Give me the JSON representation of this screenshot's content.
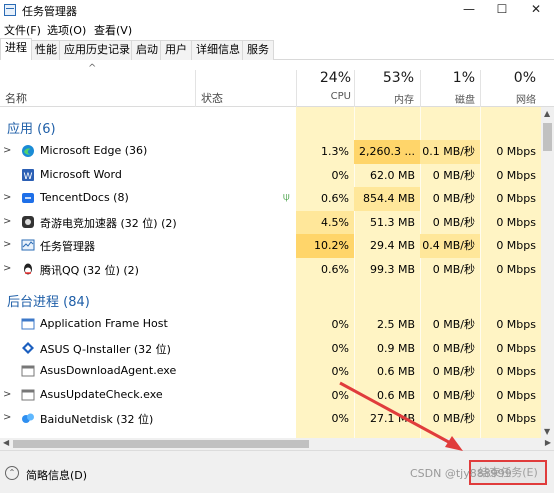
{
  "window": {
    "title": "任务管理器",
    "icon": "task-manager-icon",
    "controls": [
      "—",
      "☐",
      "✕"
    ]
  },
  "menu": [
    "文件(F)",
    "选项(O)",
    "查看(V)"
  ],
  "tabs": [
    "进程",
    "性能",
    "应用历史记录",
    "启动",
    "用户",
    "详细信息",
    "服务"
  ],
  "active_tab": "进程",
  "header": {
    "sort_arrow": "^",
    "name": "名称",
    "status": "状态",
    "cpu": {
      "pct": "24%",
      "label": "CPU"
    },
    "mem": {
      "pct": "53%",
      "label": "内存"
    },
    "disk": {
      "pct": "1%",
      "label": "磁盘"
    },
    "net": {
      "pct": "0%",
      "label": "网络"
    }
  },
  "apps": {
    "title": "应用 (6)",
    "rows": [
      {
        "name": "Microsoft Edge (36)",
        "icon": "edge-icon",
        "cpu": "1.3%",
        "mem": "2,260.3 ...",
        "disk": "0.1 MB/秒",
        "net": "0 Mbps",
        "chevron": true
      },
      {
        "name": "Microsoft Word",
        "icon": "word-icon",
        "cpu": "0%",
        "mem": "62.0 MB",
        "disk": "0 MB/秒",
        "net": "0 Mbps",
        "chevron": false
      },
      {
        "name": "TencentDocs (8)",
        "icon": "tencentdocs-icon",
        "cpu": "0.6%",
        "mem": "854.4 MB",
        "disk": "0 MB/秒",
        "net": "0 Mbps",
        "chevron": true,
        "status_icon": "leaf-icon"
      },
      {
        "name": "奇游电竞加速器 (32 位) (2)",
        "icon": "qiyou-icon",
        "cpu": "4.5%",
        "mem": "51.3 MB",
        "disk": "0 MB/秒",
        "net": "0 Mbps",
        "chevron": true
      },
      {
        "name": "任务管理器",
        "icon": "taskmgr-icon",
        "cpu": "10.2%",
        "mem": "29.4 MB",
        "disk": "0.4 MB/秒",
        "net": "0 Mbps",
        "chevron": true
      },
      {
        "name": "腾讯QQ (32 位) (2)",
        "icon": "qq-icon",
        "cpu": "0.6%",
        "mem": "99.3 MB",
        "disk": "0 MB/秒",
        "net": "0 Mbps",
        "chevron": true
      }
    ]
  },
  "background": {
    "title": "后台进程 (84)",
    "rows": [
      {
        "name": "Application Frame Host",
        "icon": "app-frame-icon",
        "cpu": "0%",
        "mem": "2.5 MB",
        "disk": "0 MB/秒",
        "net": "0 Mbps",
        "chevron": false
      },
      {
        "name": "ASUS Q-Installer (32 位)",
        "icon": "asus-icon",
        "cpu": "0%",
        "mem": "0.9 MB",
        "disk": "0 MB/秒",
        "net": "0 Mbps",
        "chevron": false
      },
      {
        "name": "AsusDownloadAgent.exe",
        "icon": "asus-download-icon",
        "cpu": "0%",
        "mem": "0.6 MB",
        "disk": "0 MB/秒",
        "net": "0 Mbps",
        "chevron": false
      },
      {
        "name": "AsusUpdateCheck.exe",
        "icon": "asus-update-icon",
        "cpu": "0%",
        "mem": "0.6 MB",
        "disk": "0 MB/秒",
        "net": "0 Mbps",
        "chevron": true
      },
      {
        "name": "BaiduNetdisk (32 位)",
        "icon": "baidu-netdisk-icon",
        "cpu": "0%",
        "mem": "27.1 MB",
        "disk": "0 MB/秒",
        "net": "0 Mbps",
        "chevron": true
      }
    ]
  },
  "footer": {
    "fewer_details": "简略信息(D)",
    "end_task": "结束任务(E)",
    "watermark": "CSDN @tjy888999"
  },
  "colors": {
    "heat_light": "#fff4c4",
    "heat_mid": "#ffe79a",
    "heat_strong": "#ffd56a",
    "section_blue": "#1f5fa8",
    "annotation_red": "#e03c3c"
  }
}
